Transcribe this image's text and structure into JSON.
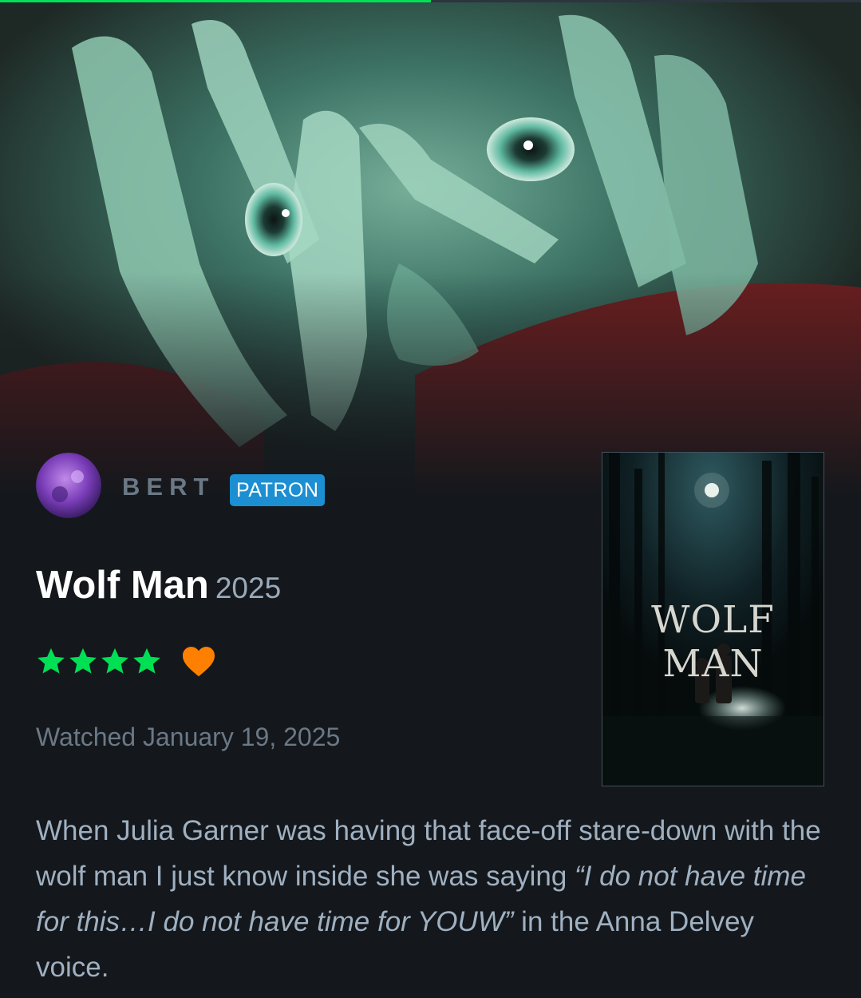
{
  "progress": {
    "fraction": 0.5,
    "fill_color": "#00e054",
    "track_color": "#2c3440"
  },
  "user": {
    "name": "BERT",
    "badge": "PATRON"
  },
  "film": {
    "title": "Wolf Man",
    "year": "2025"
  },
  "rating": {
    "stars": 4,
    "max_stars": 5,
    "liked": true,
    "star_color": "#00e054",
    "heart_color": "#ff8000"
  },
  "watched": "Watched January 19, 2025",
  "poster": {
    "title_text": "WOLF MAN"
  },
  "review": {
    "text_start": "When Julia Garner was having that face-off stare-down with the wolf man I just know inside she was saying ",
    "quote": "“I do not have time for this…I do not have time for YOUW”",
    "text_end": " in the Anna Delvey voice."
  },
  "icons": [
    "star-icon",
    "heart-icon"
  ]
}
